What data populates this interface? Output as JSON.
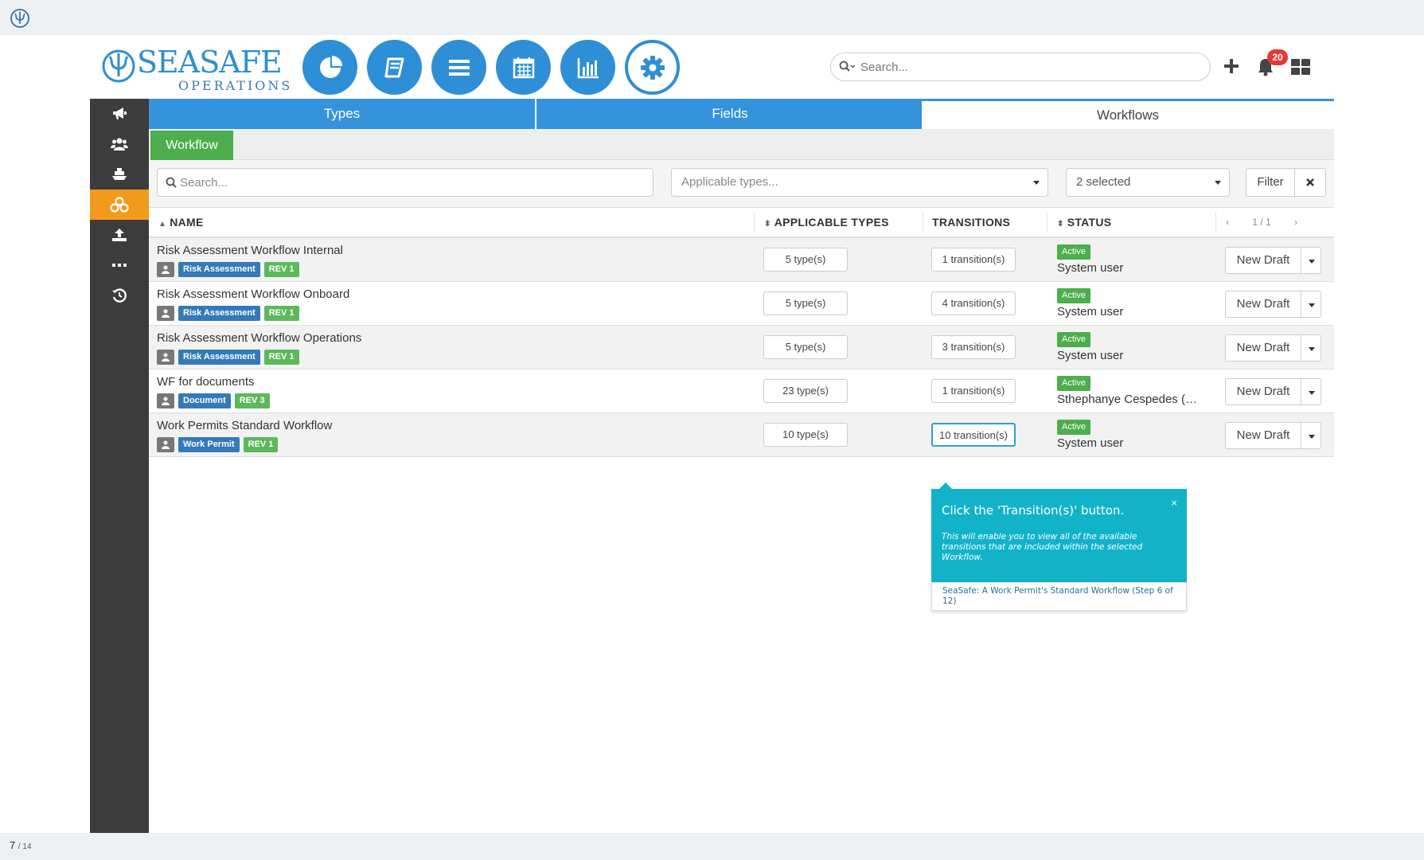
{
  "brand": {
    "name": "SEASAFE",
    "sub": "OPERATIONS"
  },
  "header": {
    "search_placeholder": "Search...",
    "notification_count": "20",
    "nav_icons": [
      "dashboard-pie-icon",
      "book-icon",
      "menu-lines-icon",
      "calendar-icon",
      "bar-chart-icon",
      "gear-icon"
    ]
  },
  "sidebar": {
    "items": [
      "megaphone-icon",
      "users-icon",
      "ship-icon",
      "workflow-icon",
      "upload-icon",
      "more-icon",
      "history-icon"
    ],
    "active_index": 3
  },
  "tabs": {
    "types": "Types",
    "fields": "Fields",
    "workflows": "Workflows"
  },
  "subtab": {
    "label": "Workflow"
  },
  "filters": {
    "search_placeholder": "Search...",
    "types_placeholder": "Applicable types...",
    "status_value": "2 selected",
    "filter_label": "Filter"
  },
  "table": {
    "headers": {
      "name": "NAME",
      "types": "APPLICABLE TYPES",
      "transitions": "TRANSITIONS",
      "status": "STATUS"
    },
    "pager": {
      "prev": "‹",
      "page": "1 / 1",
      "next": "›"
    },
    "rows": [
      {
        "name": "Risk Assessment Workflow Internal",
        "type_tag": "Risk Assessment",
        "rev": "REV 1",
        "types": "5 type(s)",
        "transitions": "1 transition(s)",
        "status": "Active",
        "user": "System user",
        "action": "New Draft"
      },
      {
        "name": "Risk Assessment Workflow Onboard",
        "type_tag": "Risk Assessment",
        "rev": "REV 1",
        "types": "5 type(s)",
        "transitions": "4 transition(s)",
        "status": "Active",
        "user": "System user",
        "action": "New Draft"
      },
      {
        "name": "Risk Assessment Workflow Operations",
        "type_tag": "Risk Assessment",
        "rev": "REV 1",
        "types": "5 type(s)",
        "transitions": "3 transition(s)",
        "status": "Active",
        "user": "System user",
        "action": "New Draft"
      },
      {
        "name": "WF for documents",
        "type_tag": "Document",
        "rev": "REV 3",
        "types": "23 type(s)",
        "transitions": "1 transition(s)",
        "status": "Active",
        "user": "Sthephanye Cespedes (C...",
        "action": "New Draft"
      },
      {
        "name": "Work Permits Standard Workflow",
        "type_tag": "Work Permit",
        "rev": "REV 1",
        "types": "10 type(s)",
        "transitions": "10 transition(s)",
        "status": "Active",
        "user": "System user",
        "action": "New Draft"
      }
    ]
  },
  "tooltip": {
    "close": "×",
    "title": "Click the 'Transition(s)' button.",
    "description": "This will enable you to view all of the available transitions that are included within the selected Workflow.",
    "footer": "SeaSafe: A Work Permit's Standard Workflow (Step 6 of 12)"
  },
  "footer": {
    "page": "7",
    "total": "/ 14"
  },
  "colors": {
    "primary": "#3493db",
    "accent": "#f39a1c",
    "success": "#4cae4c",
    "tooltip": "#12b3c9",
    "badge": "#e53935"
  }
}
